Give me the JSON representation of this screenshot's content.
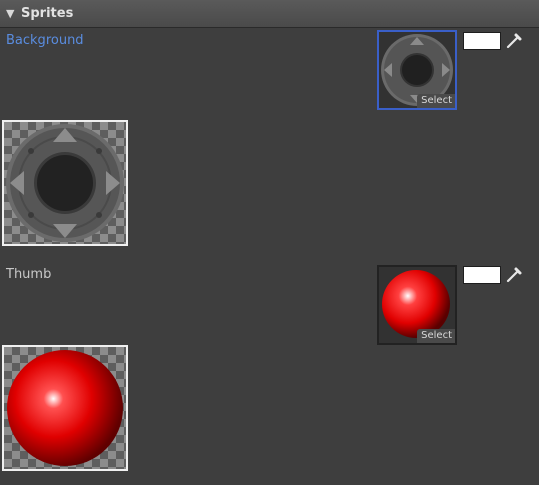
{
  "section": {
    "title": "Sprites",
    "expanded": true,
    "toggle_icon": "triangle-down-icon"
  },
  "sprites": [
    {
      "label": "Background",
      "select_label": "Select",
      "tint_color": "#ffffff",
      "active": true
    },
    {
      "label": "Thumb",
      "select_label": "Select",
      "tint_color": "#ffffff",
      "active": false
    }
  ],
  "colors": {
    "panel_bg": "#3e3e3e",
    "accent": "#5a8de0",
    "focus_border": "#3a5fc8",
    "thumb_red": "#e00000"
  }
}
